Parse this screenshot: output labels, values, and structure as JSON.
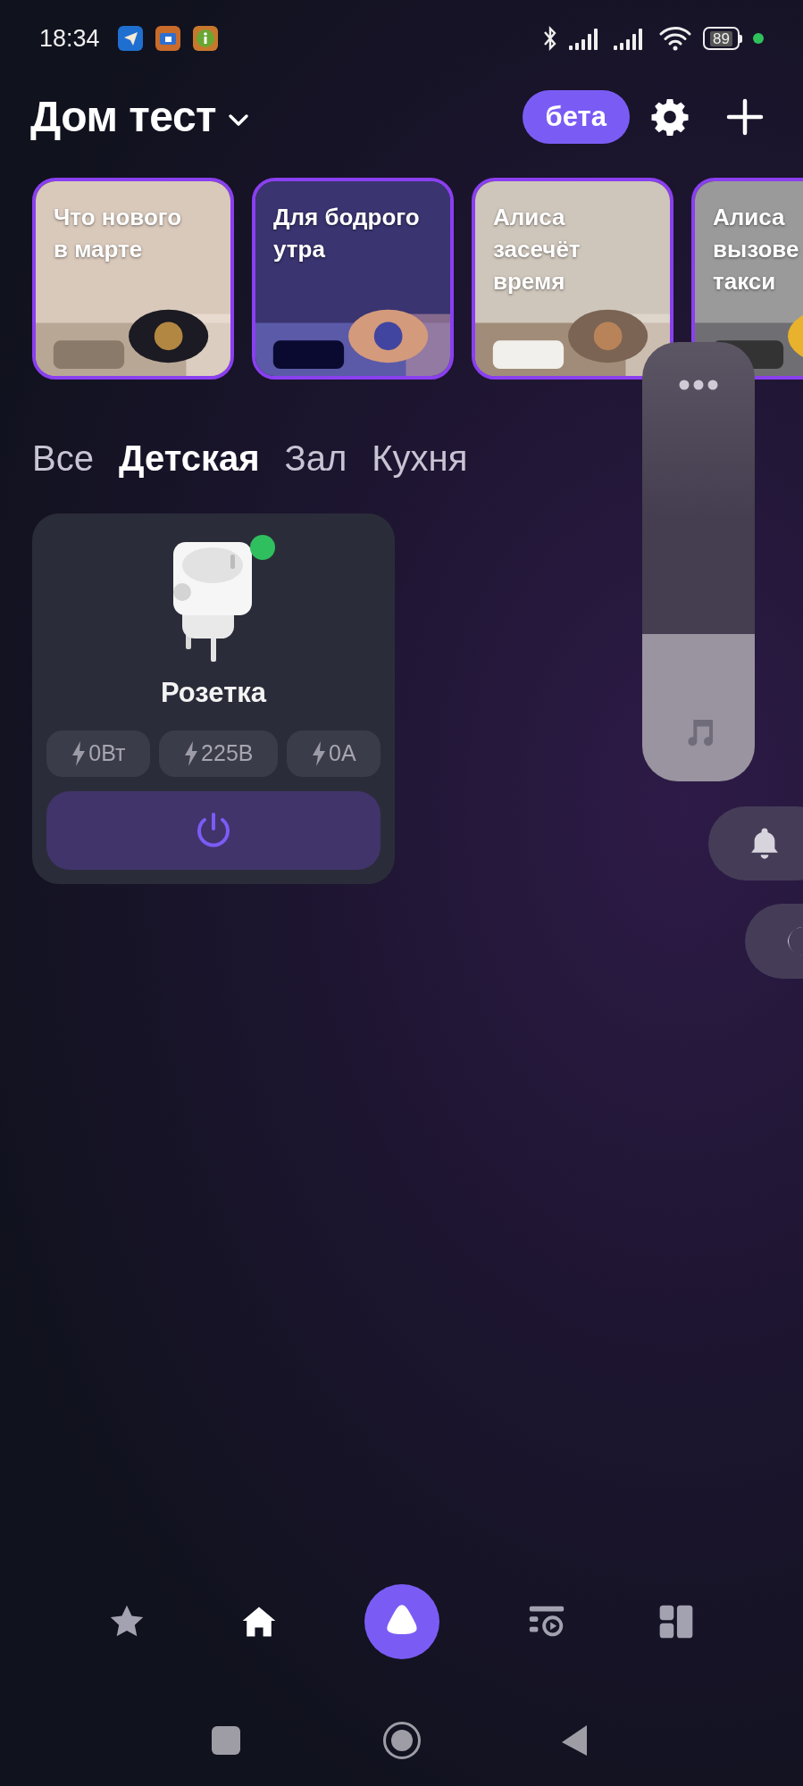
{
  "status_bar": {
    "time": "18:34",
    "battery": "89"
  },
  "header": {
    "title": "Дом тест",
    "badge": "бета"
  },
  "stories": [
    {
      "lines": [
        "Что нового",
        "в марте"
      ],
      "kind": "picture"
    },
    {
      "lines": [
        "Для бодрого",
        "утра"
      ],
      "kind": "picture"
    },
    {
      "lines": [
        "Алиса",
        "засечёт",
        "время"
      ],
      "kind": "picture"
    },
    {
      "lines": [
        "Алиса",
        "вызове",
        "такси"
      ],
      "kind": "picture"
    }
  ],
  "rooms": [
    {
      "label": "Все",
      "selected": false
    },
    {
      "label": "Детская",
      "selected": true
    },
    {
      "label": "Зал",
      "selected": false
    },
    {
      "label": "Кухня",
      "selected": false
    }
  ],
  "devices": [
    {
      "name": "Розетка",
      "online": true,
      "on": false,
      "readings": [
        "0Вт",
        "225В",
        "0А"
      ]
    }
  ],
  "volume": {
    "level": 0.335
  },
  "nav": [
    {
      "kind": "favorites",
      "selected": false
    },
    {
      "kind": "home",
      "selected": true
    },
    {
      "kind": "alice",
      "selected": false
    },
    {
      "kind": "feed",
      "selected": false
    },
    {
      "kind": "widgets",
      "selected": false
    }
  ]
}
